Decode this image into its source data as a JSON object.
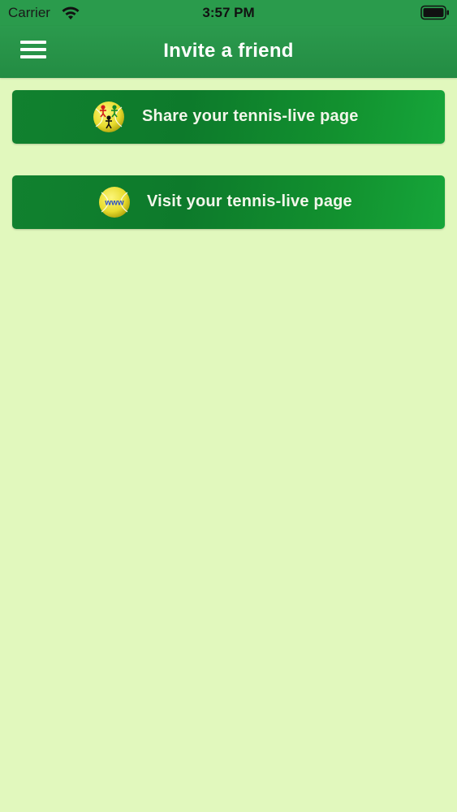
{
  "status_bar": {
    "carrier": "Carrier",
    "time": "3:57 PM",
    "icons": [
      "wifi-icon",
      "battery-icon"
    ]
  },
  "nav": {
    "title": "Invite a friend",
    "menu_icon": "hamburger-menu-icon"
  },
  "actions": {
    "share": {
      "label": "Share your tennis-live page",
      "icon": "tennis-ball-players-icon"
    },
    "visit": {
      "label": "Visit your tennis-live page",
      "icon": "tennis-ball-www-icon",
      "icon_text": "www"
    }
  },
  "colors": {
    "background": "#e1f8bd",
    "nav_bar": "#2a9b4c",
    "button": "#0f8a2f",
    "button_text": "#f2f6ea",
    "ball_yellow": "#f2e94a",
    "www_text": "#2a4fc8"
  }
}
